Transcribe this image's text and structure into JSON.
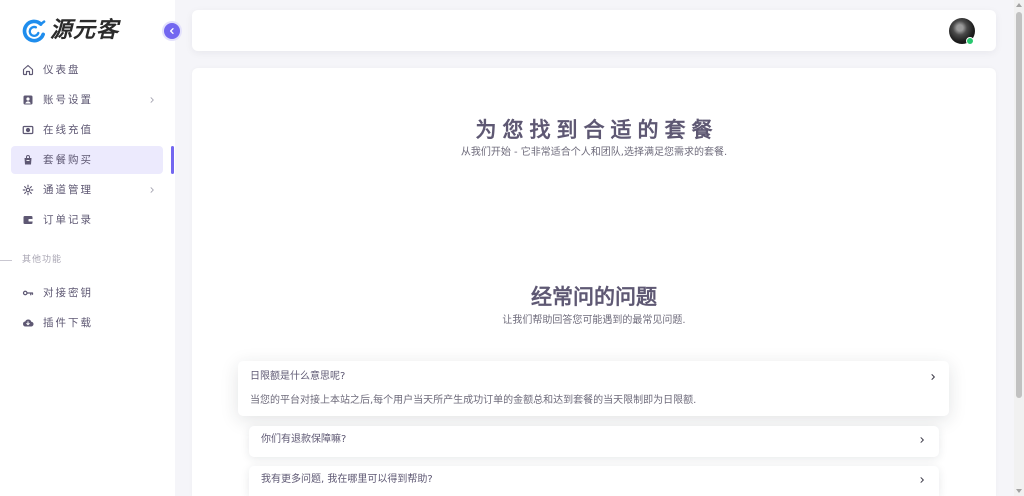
{
  "logo": {
    "text": "源元客",
    "mark_icon": "swirl-logo-icon"
  },
  "sidebar": {
    "collapse_icon": "chevron-left-icon",
    "items": [
      {
        "label": "仪表盘",
        "icon": "home-icon"
      },
      {
        "label": "账号设置",
        "icon": "user-card-icon",
        "has_submenu": true
      },
      {
        "label": "在线充值",
        "icon": "banknote-icon"
      },
      {
        "label": "套餐购买",
        "icon": "shopping-bag-icon",
        "active": true
      },
      {
        "label": "通道管理",
        "icon": "gear-icon",
        "has_submenu": true
      },
      {
        "label": "订单记录",
        "icon": "wallet-icon"
      }
    ],
    "section_title": "其他功能",
    "other_items": [
      {
        "label": "对接密钥",
        "icon": "key-icon"
      },
      {
        "label": "插件下载",
        "icon": "cloud-download-icon"
      }
    ]
  },
  "header": {
    "online": true
  },
  "pricing": {
    "title": "为您找到合适的套餐",
    "subtitle": "从我们开始 - 它非常适合个人和团队,选择满足您需求的套餐."
  },
  "faq": {
    "title": "经常问的问题",
    "subtitle": "让我们帮助回答您可能遇到的最常见问题.",
    "items": [
      {
        "question": "日限额是什么意思呢?",
        "answer": "当您的平台对接上本站之后,每个用户当天所产生成功订单的金额总和达到套餐的当天限制即为日限额.",
        "expanded": true
      },
      {
        "question": "你们有退款保障嘛?",
        "expanded": false
      },
      {
        "question": "我有更多问题, 我在哪里可以得到帮助?",
        "expanded": false
      }
    ]
  },
  "colors": {
    "accent": "#7367f0",
    "active_bg": "#eceafd",
    "text": "#5e5873",
    "muted_text": "#6e6b7b",
    "page_bg": "#f5f5f9",
    "online": "#28c76f",
    "logo": "#1f8ded"
  }
}
